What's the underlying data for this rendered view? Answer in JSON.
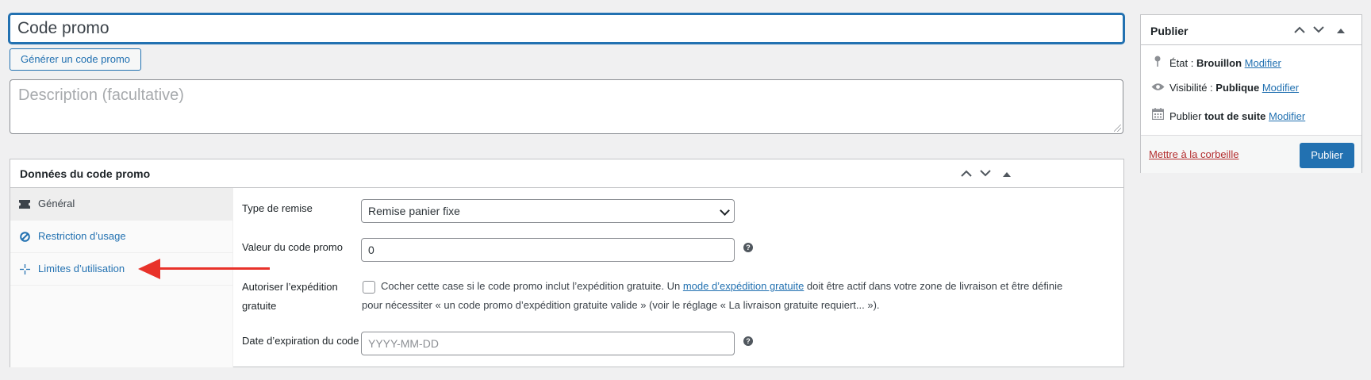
{
  "coupon": {
    "title_value": "Code promo",
    "generate_label": "Générer un code promo",
    "description_placeholder": "Description (facultative)"
  },
  "coupon_data": {
    "title": "Données du code promo",
    "tabs": [
      {
        "label": "Général",
        "icon": "ticket-icon",
        "active": true
      },
      {
        "label": "Restriction d’usage",
        "icon": "no-entry-icon",
        "active": false
      },
      {
        "label": "Limites d’utilisation",
        "icon": "crosshair-icon",
        "active": false
      }
    ],
    "discount_type": {
      "label": "Type de remise",
      "value": "Remise panier fixe"
    },
    "amount": {
      "label": "Valeur du code promo",
      "value": "0"
    },
    "free_shipping": {
      "label_line1": "Autoriser l’expédition",
      "label_line2": "gratuite",
      "text_before": "Cocher cette case si le code promo inclut l’expédition gratuite. Un ",
      "link_text": "mode d’expédition gratuite",
      "text_after_line1": " doit être actif dans votre zone de livraison et être définie",
      "text_line2": "pour nécessiter « un code promo d’expédition gratuite valide » (voir le réglage « La livraison gratuite requiert... »)."
    },
    "expiry": {
      "label": "Date d’expiration du code",
      "placeholder": "YYYY-MM-DD"
    },
    "help_glyph": "?"
  },
  "publish": {
    "title": "Publier",
    "status_label": "État : ",
    "status_value": "Brouillon",
    "visibility_label": "Visibilité : ",
    "visibility_value": "Publique",
    "schedule_label": "Publier ",
    "schedule_value": "tout de suite",
    "edit_link": "Modifier",
    "trash_label": "Mettre à la corbeille",
    "publish_button": "Publier"
  },
  "colors": {
    "accent": "#2271b1",
    "arrow": "#e8322a",
    "trash": "#b32d2e"
  }
}
